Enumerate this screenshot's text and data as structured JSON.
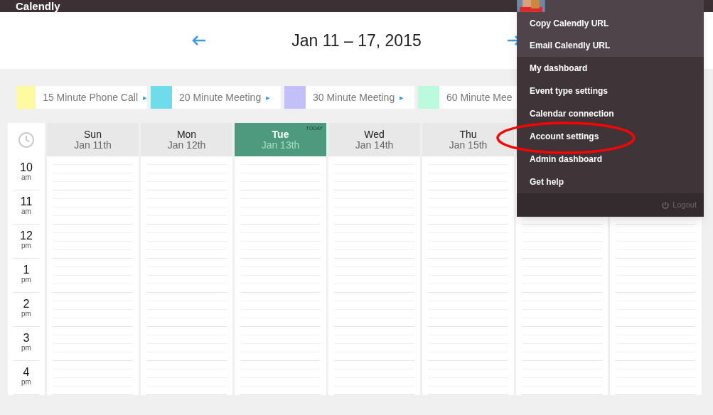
{
  "app": {
    "logo": "Calendly"
  },
  "week": {
    "title": "Jan 11 – 17, 2015"
  },
  "event_types": [
    {
      "label": "15 Minute Phone Call",
      "color": "#fffaa0",
      "arrow": "▸"
    },
    {
      "label": "20 Minute Meeting",
      "color": "#6fdcec",
      "arrow": "▸"
    },
    {
      "label": "30 Minute Meeting",
      "color": "#c3c0f9",
      "arrow": "▸"
    },
    {
      "label": "60 Minute Mee",
      "color": "#b9fbdc"
    }
  ],
  "days": [
    {
      "name": "Sun",
      "date": "Jan 11th",
      "selected": false
    },
    {
      "name": "Mon",
      "date": "Jan 12th",
      "selected": false
    },
    {
      "name": "Tue",
      "date": "Jan 13th",
      "selected": true,
      "badge": "TODAY"
    },
    {
      "name": "Wed",
      "date": "Jan 14th",
      "selected": false
    },
    {
      "name": "Thu",
      "date": "Jan 15th",
      "selected": false
    }
  ],
  "hours": [
    {
      "hour": "10",
      "period": "am"
    },
    {
      "hour": "11",
      "period": "am"
    },
    {
      "hour": "12",
      "period": "pm"
    },
    {
      "hour": "1",
      "period": "pm"
    },
    {
      "hour": "2",
      "period": "pm"
    },
    {
      "hour": "3",
      "period": "pm"
    },
    {
      "hour": "4",
      "period": "pm"
    }
  ],
  "menu": {
    "top_items": [
      "Copy Calendly URL",
      "Email Calendly URL"
    ],
    "items": [
      "My dashboard",
      "Event type settings",
      "Calendar connection",
      "Account settings",
      "Admin dashboard",
      "Get help"
    ],
    "logout": "Logout"
  }
}
